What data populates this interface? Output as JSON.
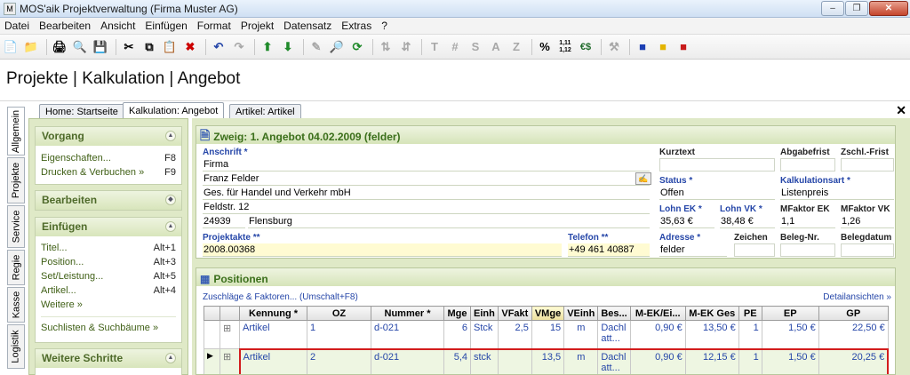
{
  "window": {
    "title": "MOS'aik Projektverwaltung (Firma Muster AG)",
    "app_icon": "M"
  },
  "menu": [
    "Datei",
    "Bearbeiten",
    "Ansicht",
    "Einfügen",
    "Format",
    "Projekt",
    "Datensatz",
    "Extras",
    "?"
  ],
  "toolbar": {
    "letters": [
      "T",
      "#",
      "S",
      "A",
      "Z"
    ],
    "percent": "%",
    "numfmt": "1,11\n1,12",
    "currency": "€$"
  },
  "page": {
    "heading": "Projekte | Kalkulation | Angebot"
  },
  "tabs": [
    "Home: Startseite",
    "Kalkulation: Angebot",
    "Artikel: Artikel"
  ],
  "vtabs": [
    "Allgemein",
    "Projekte",
    "Service",
    "Regie",
    "Kasse",
    "Logistik"
  ],
  "left": {
    "vorgang": {
      "title": "Vorgang",
      "items": [
        {
          "label": "Eigenschaften...",
          "key": "F8"
        },
        {
          "label": "Drucken & Verbuchen »",
          "key": "F9"
        }
      ]
    },
    "bearbeiten": {
      "title": "Bearbeiten"
    },
    "einfuegen": {
      "title": "Einfügen",
      "items": [
        {
          "label": "Titel...",
          "key": "Alt+1"
        },
        {
          "label": "Position...",
          "key": "Alt+3"
        },
        {
          "label": "Set/Leistung...",
          "key": "Alt+5"
        },
        {
          "label": "Artikel...",
          "key": "Alt+4"
        },
        {
          "label": "Weitere »",
          "key": ""
        }
      ],
      "extra": "Suchlisten & Suchbäume »"
    },
    "weitere": {
      "title": "Weitere Schritte"
    }
  },
  "zweig": {
    "title": "Zweig: 1. Angebot 04.02.2009 (felder)",
    "anschrift_label": "Anschrift *",
    "anschrift": [
      "Firma",
      "Franz Felder",
      "Ges. für Handel und Verkehr mbH",
      "Feldstr. 12"
    ],
    "plz": "24939",
    "ort": "Flensburg",
    "projektakte_label": "Projektakte **",
    "projektakte": "2008.00368",
    "telefon_label": "Telefon **",
    "telefon": "+49 461 40887",
    "kurztext_label": "Kurztext",
    "kurztext": "",
    "abgabefrist_label": "Abgabefrist",
    "abgabefrist": "",
    "zschl_label": "Zschl.-Frist",
    "zschl": "",
    "status_label": "Status *",
    "status": "Offen",
    "kalkart_label": "Kalkulationsart *",
    "kalkart": "Listenpreis",
    "lohnek_label": "Lohn EK *",
    "lohnek": "35,63 €",
    "lohnvk_label": "Lohn VK *",
    "lohnvk": "38,48 €",
    "mfek_label": "MFaktor EK",
    "mfek": "1,1",
    "mfvk_label": "MFaktor VK",
    "mfvk": "1,26",
    "adresse_label": "Adresse *",
    "adresse": "felder",
    "zeichen_label": "Zeichen",
    "zeichen": "",
    "belegnr_label": "Beleg-Nr.",
    "belegnr": "",
    "belegdatum_label": "Belegdatum",
    "belegdatum": ""
  },
  "positionen": {
    "title": "Positionen",
    "zuschlaege": "Zuschläge & Faktoren... (Umschalt+F8)",
    "details": "Detailansichten »",
    "columns": [
      "Kennung *",
      "OZ",
      "Nummer *",
      "Mge",
      "Einh",
      "VFakt",
      "VMge",
      "VEinh",
      "Bes...",
      "M-EK/Ei...",
      "M-EK Ges",
      "PE",
      "EP",
      "GP"
    ],
    "rows": [
      {
        "kennung": "Artikel",
        "oz": "1",
        "nummer": "d-021",
        "mge": "6",
        "einh": "Stck",
        "vfakt": "2,5",
        "vmge": "15",
        "veinh": "m",
        "bes": "Dachl\natt...",
        "mek": "0,90 €",
        "mekges": "13,50 €",
        "pe": "1",
        "ep": "1,50 €",
        "gp": "22,50 €"
      },
      {
        "kennung": "Artikel",
        "oz": "2",
        "nummer": "d-021",
        "mge": "5,4",
        "einh": "stck",
        "vfakt": "",
        "vmge": "13,5",
        "veinh": "m",
        "bes": "Dachl\natt...",
        "mek": "0,90 €",
        "mekges": "12,15 €",
        "pe": "1",
        "ep": "1,50 €",
        "gp": "20,25 €"
      }
    ]
  }
}
